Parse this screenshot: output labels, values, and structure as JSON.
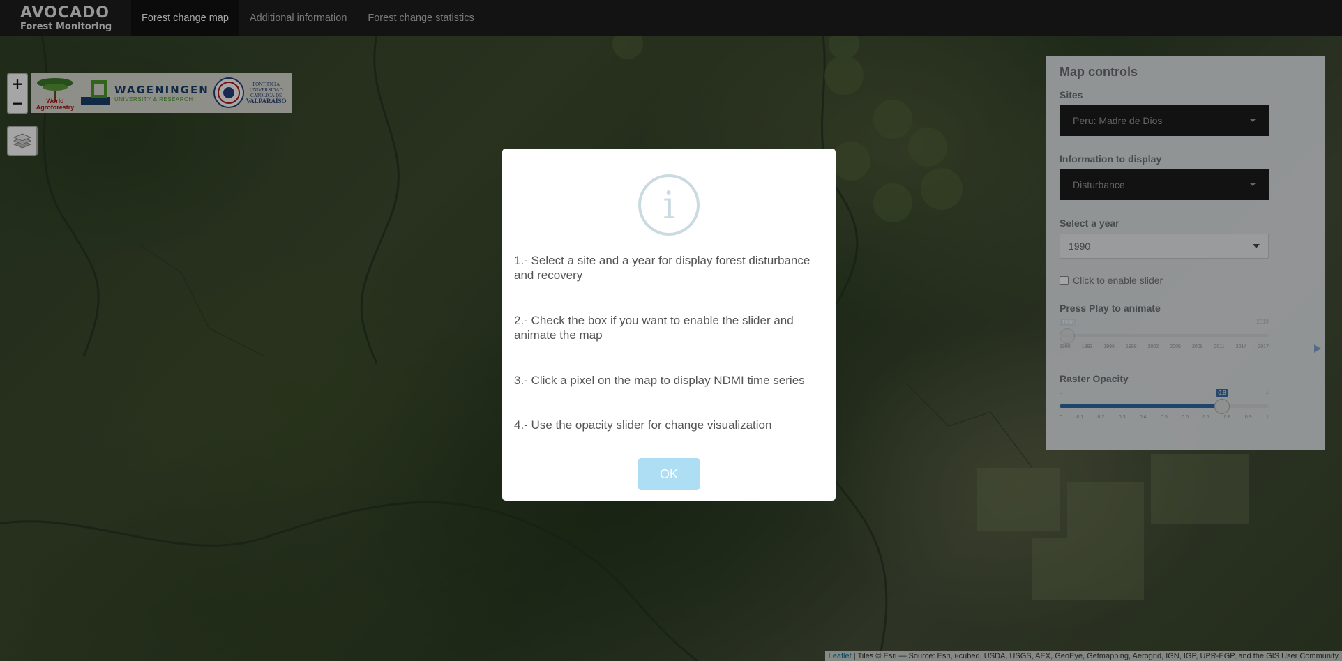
{
  "brand": {
    "name": "AVOCADO",
    "subtitle": "Forest Monitoring"
  },
  "nav": {
    "tabs": [
      {
        "label": "Forest change map",
        "active": true
      },
      {
        "label": "Additional information",
        "active": false
      },
      {
        "label": "Forest change statistics",
        "active": false
      }
    ]
  },
  "map": {
    "zoom_in": "+",
    "zoom_out": "−",
    "logos": {
      "world_agroforestry": "World Agroforestry",
      "wageningen": "WAGENINGEN",
      "wageningen_sub": "UNIVERSITY & RESEARCH",
      "pucv_1": "PONTIFICIA",
      "pucv_2": "UNIVERSIDAD",
      "pucv_3": "CATÓLICA DE",
      "pucv_4": "VALPARAÍSO"
    },
    "layers_icon": "layers-icon",
    "attribution_link": "Leaflet",
    "attribution_text": " | Tiles © Esri — Source: Esri, i-cubed, USDA, USGS, AEX, GeoEye, Getmapping, Aerogrid, IGN, IGP, UPR-EGP, and the GIS User Community"
  },
  "controls": {
    "title": "Map controls",
    "sites_label": "Sites",
    "sites_value": "Peru: Madre de Dios",
    "info_label": "Information to display",
    "info_value": "Disturbance",
    "year_label": "Select a year",
    "year_value": "1990",
    "checkbox_label": "Click to enable slider",
    "animate_label": "Press Play to animate",
    "year_slider": {
      "min": "1990",
      "max": "2019",
      "current": "1990",
      "fraction": 0,
      "grid": [
        "1990",
        "1993",
        "1996",
        "1999",
        "2002",
        "2005",
        "2008",
        "2011",
        "2014",
        "2017"
      ]
    },
    "opacity_label": "Raster Opacity",
    "opacity_slider": {
      "min": "0",
      "max": "1",
      "current": "0.8",
      "fraction": 0.8,
      "grid": [
        "0",
        "0.1",
        "0.2",
        "0.3",
        "0.4",
        "0.5",
        "0.6",
        "0.7",
        "0.8",
        "0.9",
        "1"
      ]
    }
  },
  "modal": {
    "icon": "info-icon",
    "step1": "1.- Select a site and a year for display forest disturbance and recovery",
    "step2": "2.- Check the box if you want to enable the slider and animate the map",
    "step3": "3.- Click a pixel on the map to display NDMI time series",
    "step4": "4.- Use the opacity slider for change visualization",
    "ok": "OK"
  },
  "colors": {
    "navbar": "#1e1e1e",
    "accent": "#2f6aa6",
    "ok_button": "#aedef4"
  }
}
